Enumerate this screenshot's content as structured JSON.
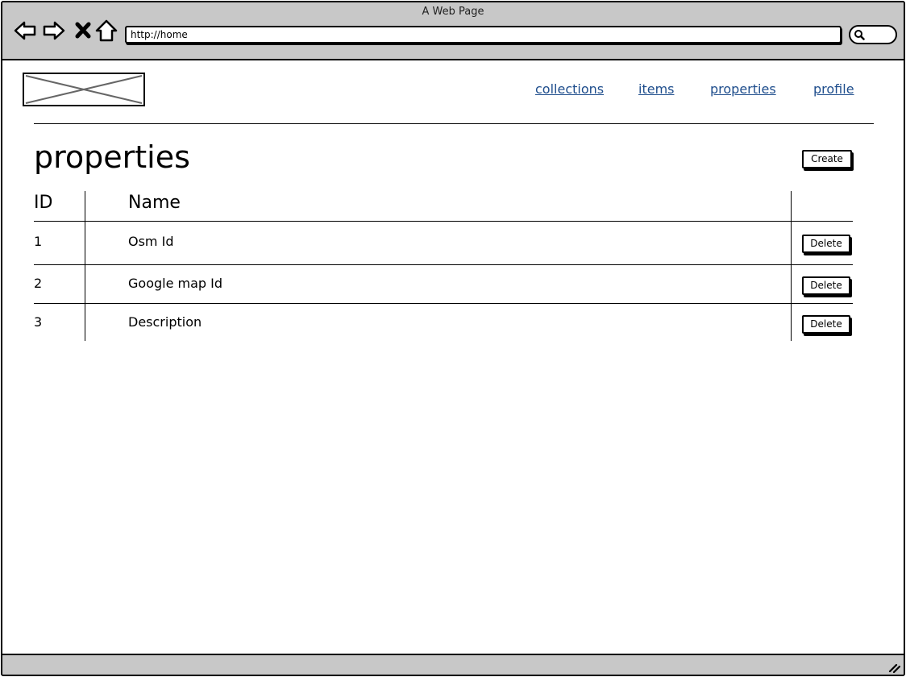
{
  "window": {
    "title": "A Web Page"
  },
  "browser": {
    "url": "http://home",
    "back_icon": "back-arrow-icon",
    "forward_icon": "forward-arrow-icon",
    "stop_icon": "close-x-icon",
    "home_icon": "home-icon",
    "search_icon": "search-icon"
  },
  "nav": {
    "links": [
      {
        "label": "collections"
      },
      {
        "label": "items"
      },
      {
        "label": "properties"
      },
      {
        "label": "profile"
      }
    ],
    "link_color": "#1e4d8c"
  },
  "page": {
    "title": "properties",
    "create_label": "Create"
  },
  "table": {
    "headers": {
      "id": "ID",
      "name": "Name"
    },
    "rows": [
      {
        "id": "1",
        "name": "Osm Id",
        "action": "Delete"
      },
      {
        "id": "2",
        "name": "Google map Id",
        "action": "Delete"
      },
      {
        "id": "3",
        "name": "Description",
        "action": "Delete"
      }
    ]
  }
}
